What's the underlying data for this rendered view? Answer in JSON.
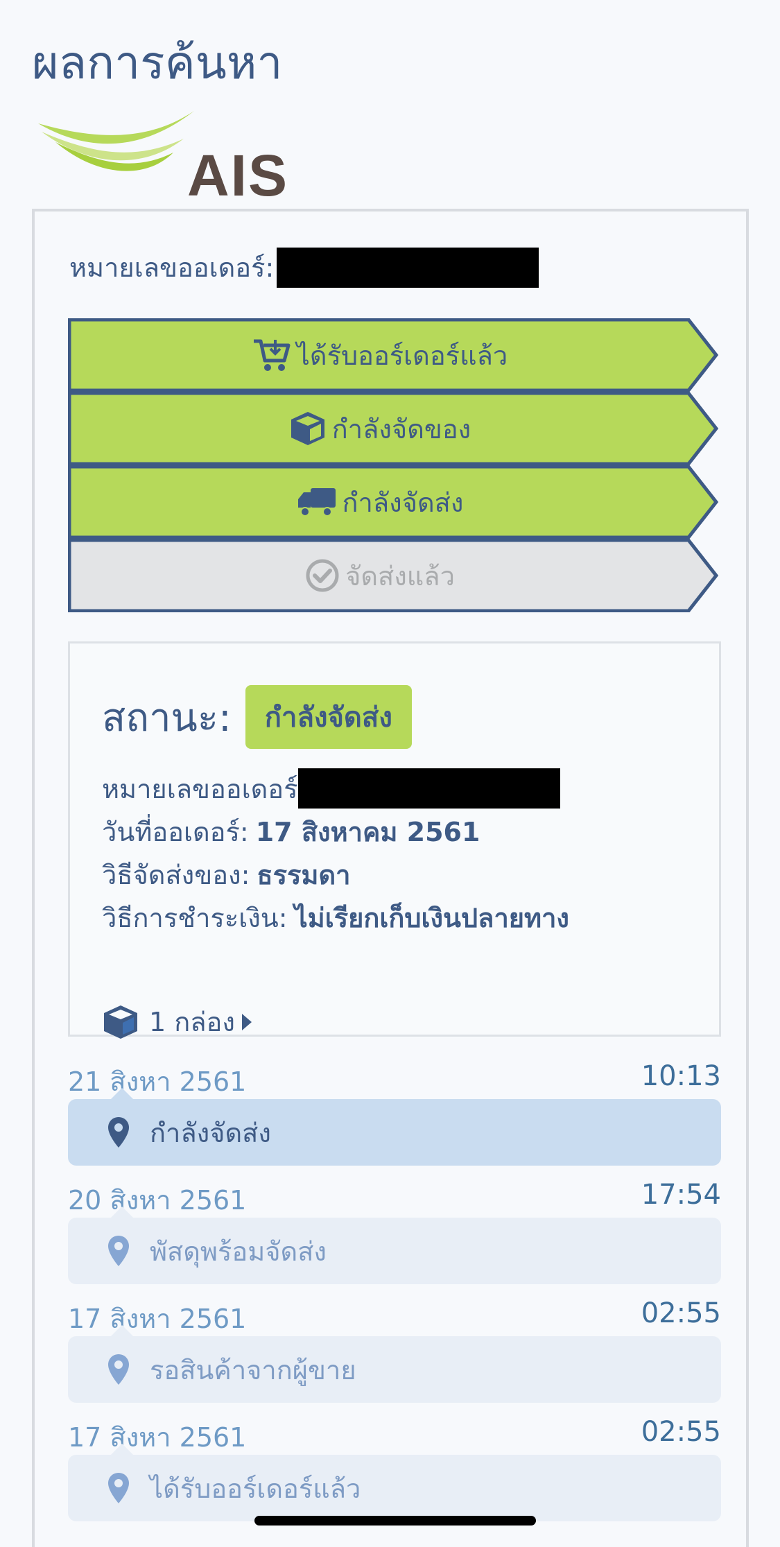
{
  "page": {
    "title": "ผลการค้นหา"
  },
  "logo": {
    "text": "AIS"
  },
  "order": {
    "number_label": "หมายเลขออเดอร์:"
  },
  "steps": [
    {
      "label": "ได้รับออร์เดอร์แล้ว",
      "icon": "cart-icon",
      "active": true
    },
    {
      "label": "กำลังจัดของ",
      "icon": "box-icon",
      "active": true
    },
    {
      "label": "กำลังจัดส่ง",
      "icon": "truck-icon",
      "active": true
    },
    {
      "label": "จัดส่งแล้ว",
      "icon": "check-circle-icon",
      "active": false
    }
  ],
  "status": {
    "label": "สถานะ:",
    "value": "กำลังจัดส่ง",
    "order_number_label": "หมายเลขออเดอร์",
    "order_date_label": "วันที่ออเดอร์:",
    "order_date_value": "17 สิงหาคม 2561",
    "shipping_method_label": "วิธีจัดส่งของ:",
    "shipping_method_value": "ธรรมดา",
    "payment_method_label": "วิธีการชำระเงิน:",
    "payment_method_value": "ไม่เรียกเก็บเงินปลายทาง",
    "boxes_label": "1 กล่อง"
  },
  "timeline": [
    {
      "date": "21 สิงหา 2561",
      "time": "10:13",
      "event": "กำลังจัดส่ง",
      "current": true
    },
    {
      "date": "20 สิงหา 2561",
      "time": "17:54",
      "event": "พัสดุพร้อมจัดส่ง",
      "current": false
    },
    {
      "date": "17 สิงหา 2561",
      "time": "02:55",
      "event": "รอสินค้าจากผู้ขาย",
      "current": false
    },
    {
      "date": "17 สิงหา 2561",
      "time": "02:55",
      "event": "ได้รับออร์เดอร์แล้ว",
      "current": false
    }
  ],
  "colors": {
    "primary": "#3e5a85",
    "active_step": "#b6d95a",
    "inactive_step": "#e3e4e6",
    "timeline_current": "#c9dcf0",
    "timeline_past": "#e8eef6"
  }
}
